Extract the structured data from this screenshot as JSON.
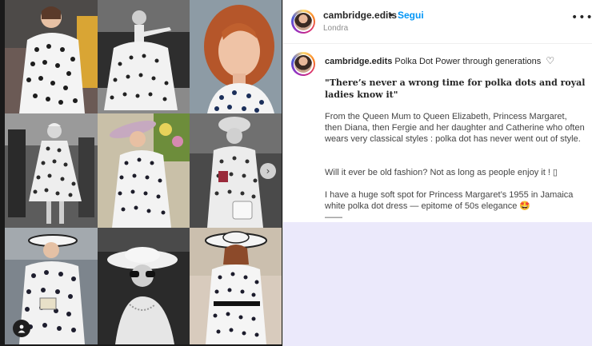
{
  "header": {
    "username": "cambridge.edits",
    "separator": "•",
    "follow_label": "Segui",
    "location": "Londra",
    "more_label": "•••"
  },
  "caption": {
    "username": "cambridge.edits",
    "title": "Polka Dot Power through generations",
    "quote": "\"There’s never a wrong time for polka dots and royal ladies know it\"",
    "paragraph1": "From the Queen Mum to Queen Elizabeth, Princess Margaret, then Diana, then Fergie and her daughter and Catherine who often wears very classical styles : polka dot has never went out of style.",
    "paragraph2": "Will it ever be old fashion? Not as long as people enjoy it ! ▯",
    "paragraph3": "I have a huge soft spot for Princess Margaret’s 1955 in Jamaica white polka dot dress — epitome of 50s elegance 🤩",
    "divider": "——"
  },
  "media": {
    "next_arrow": "›",
    "photos": [
      {
        "name": "photo-polka-dress-color-1",
        "bg": "#6b5a55"
      },
      {
        "name": "photo-polka-ballgown-bw",
        "bg": "#3a3a3a"
      },
      {
        "name": "photo-redhead-portrait",
        "bg": "#8a9aa4"
      },
      {
        "name": "photo-polka-dress-bw-1",
        "bg": "#4a4a4a"
      },
      {
        "name": "photo-polka-dress-pink-hat",
        "bg": "#b0a58f"
      },
      {
        "name": "photo-queen-mother-bw",
        "bg": "#5b5b5b"
      },
      {
        "name": "photo-diana-polka-hat",
        "bg": "#77808a"
      },
      {
        "name": "photo-sunglasses-hat-bw",
        "bg": "#2a2a2a"
      },
      {
        "name": "photo-eugenie-polka-hat",
        "bg": "#d7c7b5"
      }
    ]
  },
  "colors": {
    "follow_blue": "#0095f6",
    "panel_bg": "#ebe9fb",
    "text_dark": "#262626",
    "text_muted": "#8e8e8e"
  }
}
